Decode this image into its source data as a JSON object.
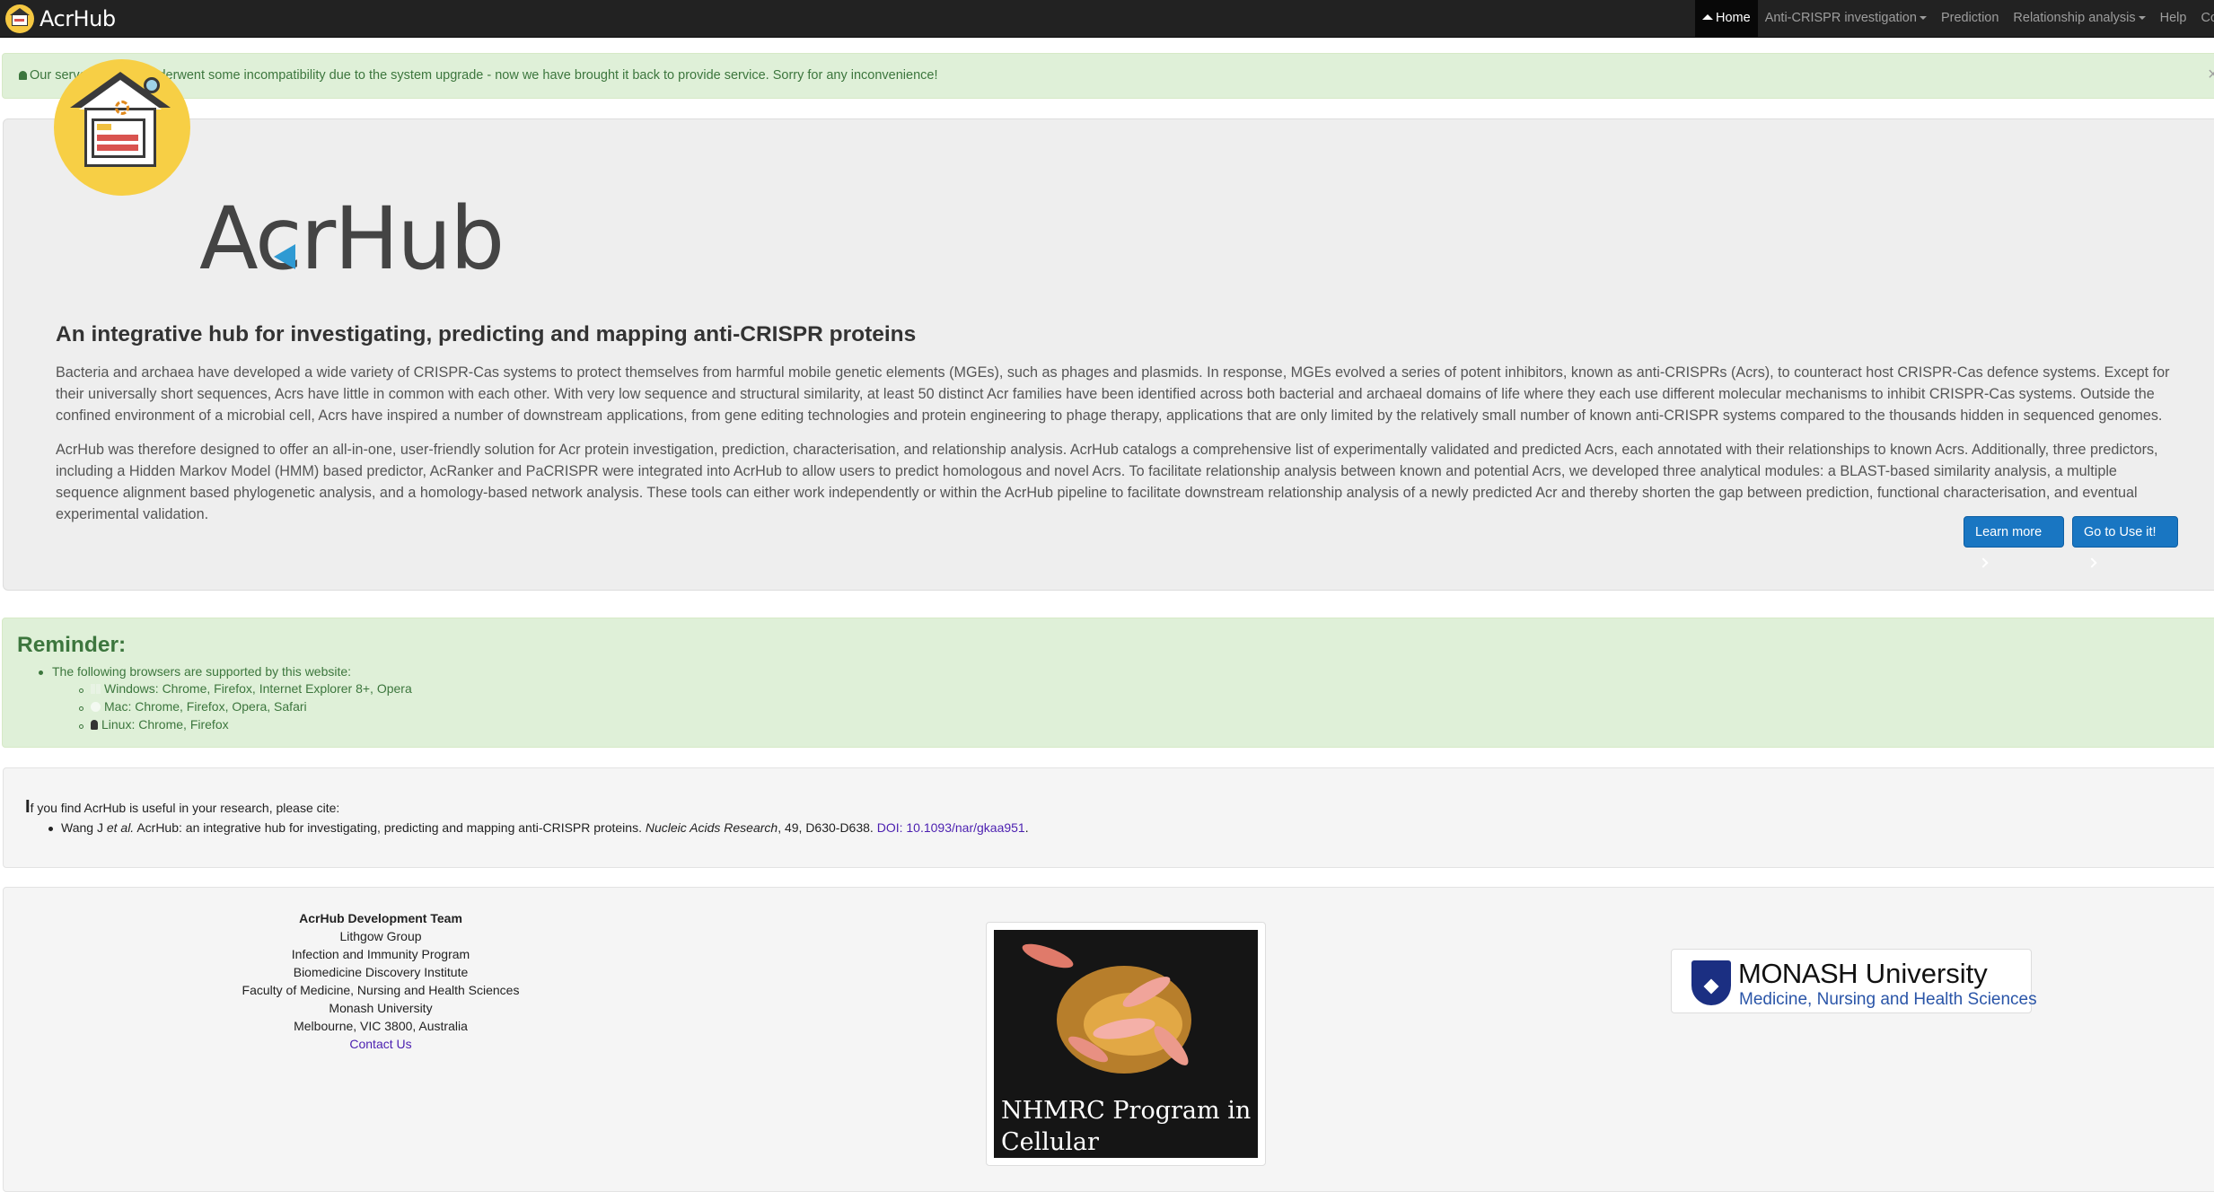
{
  "navbar": {
    "brand": "AcrHub",
    "items": [
      {
        "label": "Home",
        "active": true,
        "icon": "home-icon"
      },
      {
        "label": "Anti-CRISPR investigation",
        "dropdown": true
      },
      {
        "label": "Prediction"
      },
      {
        "label": "Relationship analysis",
        "dropdown": true
      },
      {
        "label": "Help"
      },
      {
        "label": "Cont"
      }
    ]
  },
  "alert": {
    "icon": "bell-icon",
    "text": "Our server recently underwent some incompatibility due to the system upgrade - now we have brought it back to provide service. Sorry for any inconvenience!",
    "close": "×"
  },
  "jumbotron": {
    "logo_text": "AcrHub",
    "title": "An integrative hub for investigating, predicting and mapping anti-CRISPR proteins",
    "paragraph1": "Bacteria and archaea have developed a wide variety of CRISPR-Cas systems to protect themselves from harmful mobile genetic elements (MGEs), such as phages and plasmids. In response, MGEs evolved a series of potent inhibitors, known as anti-CRISPRs (Acrs), to counteract host CRISPR-Cas defence systems. Except for their universally short sequences, Acrs have little in common with each other. With very low sequence and structural similarity, at least 50 distinct Acr families have been identified across both bacterial and archaeal domains of life where they each use different molecular mechanisms to inhibit CRISPR-Cas systems. Outside the confined environment of a microbial cell, Acrs have inspired a number of downstream applications, from gene editing technologies and protein engineering to phage therapy, applications that are only limited by the relatively small number of known anti-CRISPR systems compared to the thousands hidden in sequenced genomes.",
    "paragraph2": "AcrHub was therefore designed to offer an all-in-one, user-friendly solution for Acr protein investigation, prediction, characterisation, and relationship analysis. AcrHub catalogs a comprehensive list of experimentally validated and predicted Acrs, each annotated with their relationships to known Acrs. Additionally, three predictors, including a Hidden Markov Model (HMM) based predictor, AcRanker and PaCRISPR were integrated into AcrHub to allow users to predict homologous and novel Acrs. To facilitate relationship analysis between known and potential Acrs, we developed three analytical modules: a BLAST-based similarity analysis, a multiple sequence alignment based phylogenetic analysis, and a homology-based network analysis. These tools can either work independently or within the AcrHub pipeline to facilitate downstream relationship analysis of a newly predicted Acr and thereby shorten the gap between prediction, functional characterisation, and eventual experimental validation.",
    "learn_more": "Learn more",
    "go_use": "Go to Use it!"
  },
  "reminder": {
    "title": "Reminder:",
    "intro": "The following browsers are supported by this website:",
    "os": [
      {
        "icon": "windows-icon",
        "text": "Windows: Chrome, Firefox, Internet Explorer 8+, Opera"
      },
      {
        "icon": "apple-icon",
        "text": "Mac: Chrome, Firefox, Opera, Safari"
      },
      {
        "icon": "linux-icon",
        "text": "Linux: Chrome, Firefox"
      }
    ]
  },
  "citation": {
    "intro_first": "I",
    "intro_rest": "f you find AcrHub is useful in your research, please cite:",
    "authors": "Wang J ",
    "etal": "et al.",
    "title": " AcrHub: an integrative hub for investigating, predicting and mapping anti-CRISPR proteins. ",
    "journal": "Nucleic Acids Research",
    "volume": ", 49, D630-D638. ",
    "doi": "DOI: 10.1093/nar/gkaa951",
    "period": "."
  },
  "footer": {
    "team": [
      "AcrHub Development Team",
      "Lithgow Group",
      "Infection and Immunity Program",
      "Biomedicine Discovery Institute",
      "Faculty of Medicine, Nursing and Health Sciences",
      "Monash University",
      "Melbourne, VIC 3800, Australia"
    ],
    "contact": "Contact Us",
    "nhmrc_line1": "NHMRC Program in",
    "nhmrc_line2": "Cellular Microbiology",
    "monash_name_bold": "MONASH",
    "monash_name_rest": " University",
    "monash_faculty": "Medicine, Nursing and Health Sciences"
  }
}
